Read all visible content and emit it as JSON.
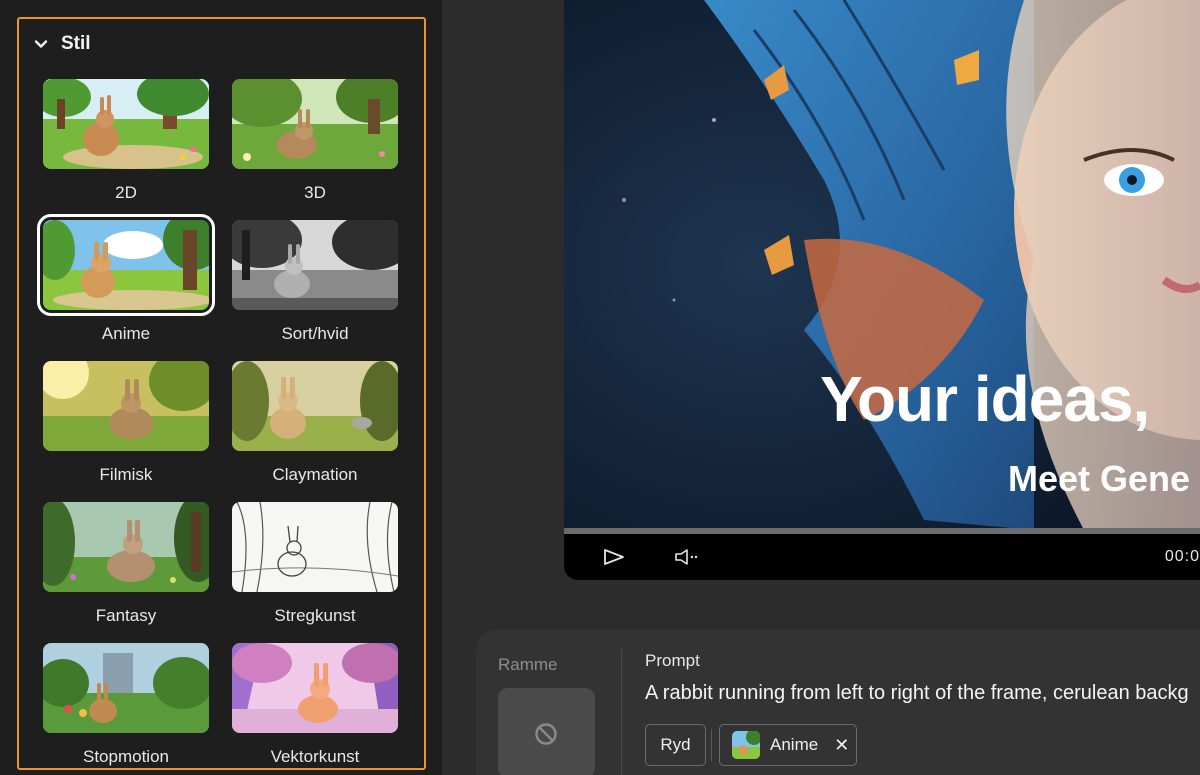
{
  "style_panel": {
    "title": "Stil",
    "styles": [
      {
        "label": "2D",
        "selected": false
      },
      {
        "label": "3D",
        "selected": false
      },
      {
        "label": "Anime",
        "selected": true
      },
      {
        "label": "Sort/hvid",
        "selected": false
      },
      {
        "label": "Filmisk",
        "selected": false
      },
      {
        "label": "Claymation",
        "selected": false
      },
      {
        "label": "Fantasy",
        "selected": false
      },
      {
        "label": "Stregkunst",
        "selected": false
      },
      {
        "label": "Stopmotion",
        "selected": false
      },
      {
        "label": "Vektorkunst",
        "selected": false
      }
    ],
    "accent_color": "#f29423"
  },
  "video": {
    "headline": "Your ideas,",
    "subheadline": "Meet Gene",
    "timecode": "00:0"
  },
  "prompt_bar": {
    "frame_label": "Ramme",
    "prompt_label": "Prompt",
    "prompt_text": "A rabbit running from left to right of the frame, cerulean backg",
    "clear_label": "Ryd",
    "style_chip_label": "Anime",
    "remove_icon_glyph": "✕"
  }
}
